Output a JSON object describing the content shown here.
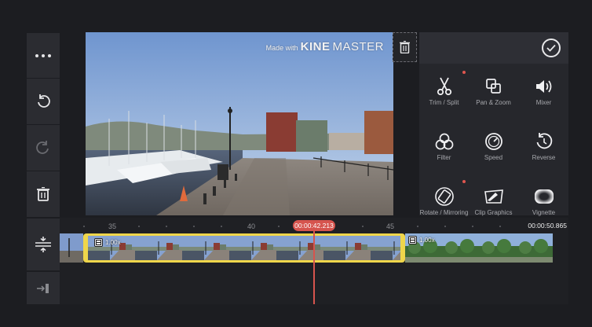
{
  "preview": {
    "watermark": {
      "prefix": "Made with",
      "brand_bold": "KINE",
      "brand_light": "MASTER"
    }
  },
  "left_toolbar": {
    "items": [
      {
        "name": "more-options",
        "icon": "ellipsis-icon"
      },
      {
        "name": "undo",
        "icon": "undo-icon"
      },
      {
        "name": "redo",
        "icon": "redo-icon"
      },
      {
        "name": "delete",
        "icon": "trash-icon"
      },
      {
        "name": "timeline-expand",
        "icon": "expand-vertical-icon"
      },
      {
        "name": "jump-to-end",
        "icon": "jump-end-icon"
      }
    ]
  },
  "clip_panel": {
    "confirm_icon": "check-circle-icon",
    "tools": [
      {
        "label": "Trim / Split",
        "icon": "scissors-icon",
        "has_dot": true
      },
      {
        "label": "Pan & Zoom",
        "icon": "pan-zoom-icon",
        "has_dot": false
      },
      {
        "label": "Mixer",
        "icon": "speaker-icon",
        "has_dot": false
      },
      {
        "label": "Filter",
        "icon": "filter-icon",
        "has_dot": false
      },
      {
        "label": "Speed",
        "icon": "speedometer-icon",
        "has_dot": false
      },
      {
        "label": "Reverse",
        "icon": "reverse-icon",
        "has_dot": false
      },
      {
        "label": "Rotate / Mirroring",
        "icon": "rotate-icon",
        "has_dot": true
      },
      {
        "label": "Clip Graphics",
        "icon": "clip-graphics-icon",
        "has_dot": false
      },
      {
        "label": "Vignette",
        "icon": "vignette-icon",
        "has_dot": false
      }
    ]
  },
  "timeline": {
    "ticks": [
      "35",
      "40",
      "45"
    ],
    "current_time": "00:00:42.213",
    "end_time": "00:00:50.865",
    "clips": [
      {
        "speed": "1.00x",
        "selected": true
      },
      {
        "speed": "1.00x",
        "selected": false
      }
    ]
  },
  "colors": {
    "accent_red": "#d6544e",
    "selection_yellow": "#efd64b",
    "background": "#1c1d21",
    "panel": "#26272c"
  }
}
